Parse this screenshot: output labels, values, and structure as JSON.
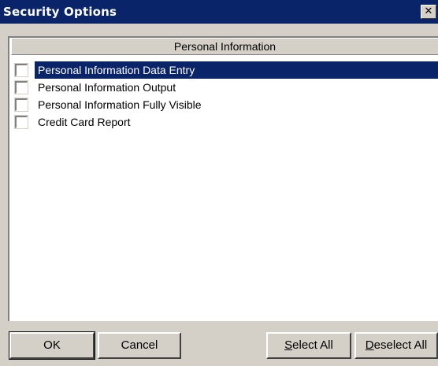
{
  "window": {
    "title": "Security Options",
    "close_glyph": "✕"
  },
  "list": {
    "header": "Personal Information",
    "items": [
      {
        "label": "Personal Information Data Entry",
        "checked": false,
        "selected": true
      },
      {
        "label": "Personal Information Output",
        "checked": false,
        "selected": false
      },
      {
        "label": "Personal Information Fully Visible",
        "checked": false,
        "selected": false
      },
      {
        "label": "Credit Card Report",
        "checked": false,
        "selected": false
      }
    ]
  },
  "buttons": {
    "ok": "OK",
    "cancel": "Cancel",
    "select_all_mnemonic": "S",
    "select_all_rest": "elect All",
    "deselect_all_mnemonic": "D",
    "deselect_all_rest": "eselect All"
  },
  "colors": {
    "titlebar": "#0a246a",
    "face": "#d4d0c8",
    "selection": "#0a246a"
  }
}
